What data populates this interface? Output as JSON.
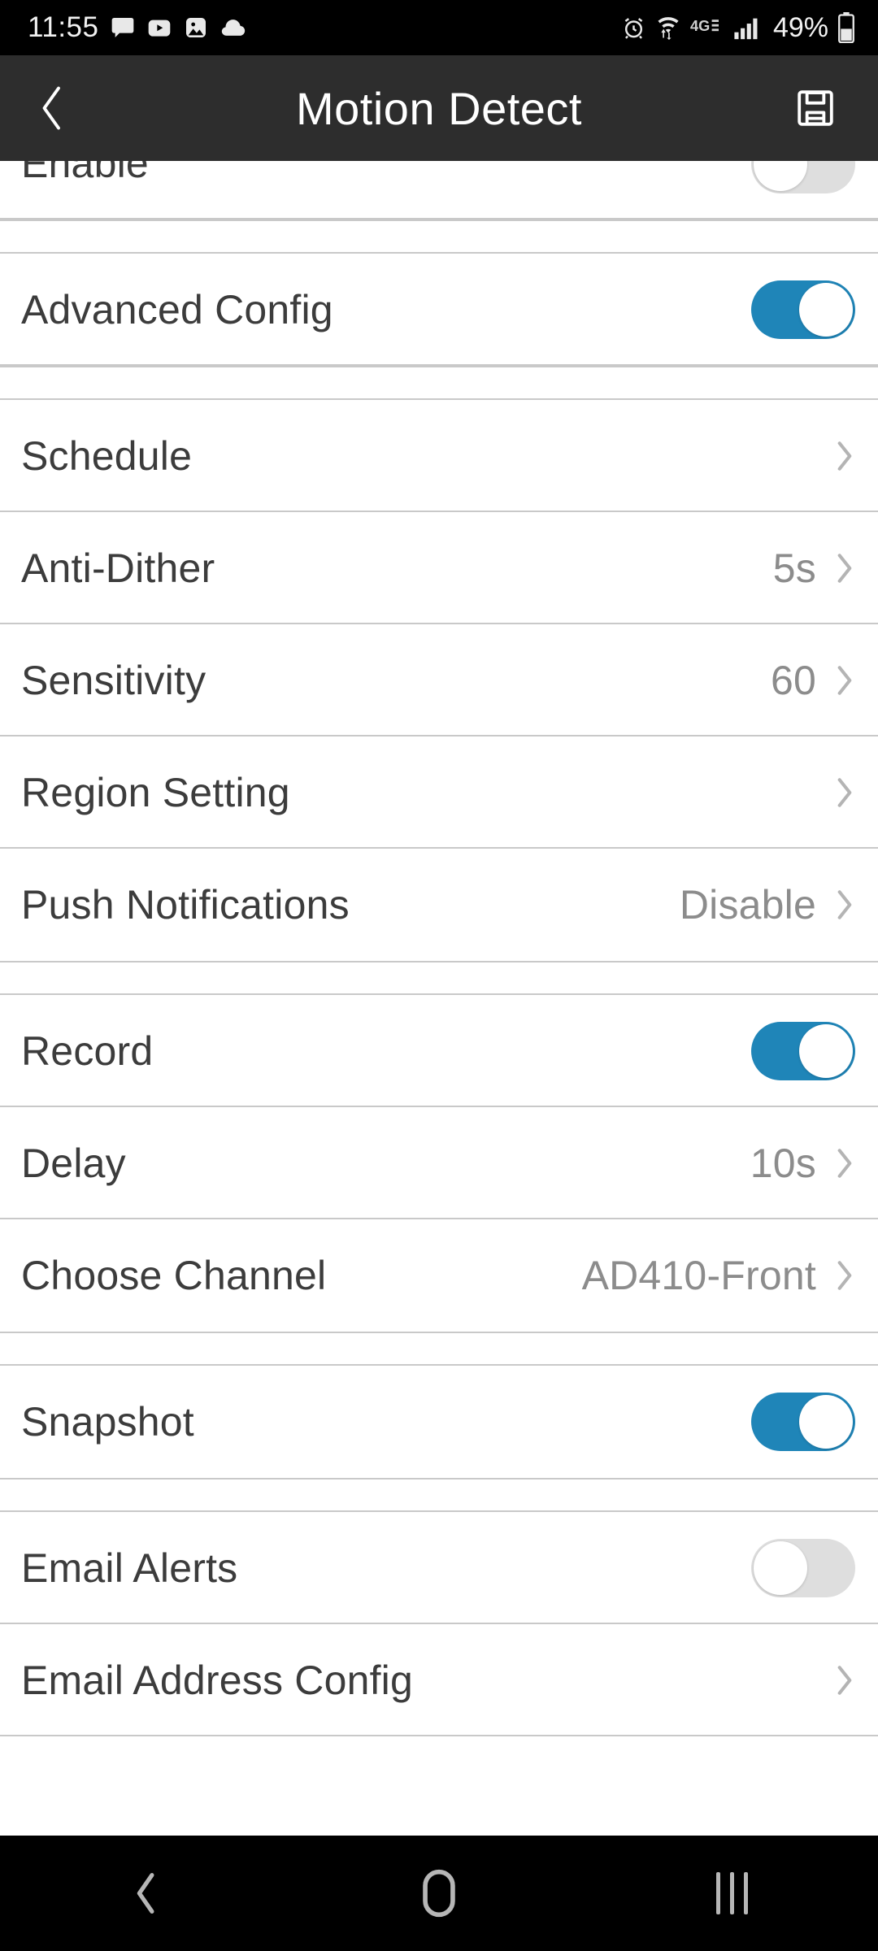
{
  "status_bar": {
    "time": "11:55",
    "left_icons": [
      "message-icon",
      "youtube-icon",
      "photos-icon",
      "cloud-icon"
    ],
    "right_icons": [
      "alarm-icon",
      "wifi-transfer-icon",
      "4g-lte-icon",
      "signal-bars-icon"
    ],
    "network_label": "4G",
    "battery_percent": "49%"
  },
  "header": {
    "back_label": "back-chevron",
    "title": "Motion Detect",
    "save_label": "save-icon"
  },
  "colors": {
    "toggle_on": "#1f85b8",
    "toggle_off": "#dedede",
    "header_bg": "#2d2d2d",
    "label_text": "#3c3c3c",
    "value_text": "#8c8c8c",
    "chevron": "#b4b4b4",
    "separator": "#c9c9c9"
  },
  "sections": [
    {
      "rows": [
        {
          "name": "enable",
          "label": "Enable",
          "control": "toggle",
          "state": "off",
          "clipped": true
        }
      ]
    },
    {
      "rows": [
        {
          "name": "advanced-config",
          "label": "Advanced Config",
          "control": "toggle",
          "state": "on"
        }
      ]
    },
    {
      "rows": [
        {
          "name": "schedule",
          "label": "Schedule",
          "control": "chevron",
          "value": ""
        },
        {
          "name": "anti-dither",
          "label": "Anti-Dither",
          "control": "chevron",
          "value": "5s"
        },
        {
          "name": "sensitivity",
          "label": "Sensitivity",
          "control": "chevron",
          "value": "60"
        },
        {
          "name": "region-setting",
          "label": "Region Setting",
          "control": "chevron",
          "value": ""
        },
        {
          "name": "push-notifications",
          "label": "Push Notifications",
          "control": "chevron",
          "value": "Disable"
        }
      ]
    },
    {
      "rows": [
        {
          "name": "record",
          "label": "Record",
          "control": "toggle",
          "state": "on"
        },
        {
          "name": "delay",
          "label": "Delay",
          "control": "chevron",
          "value": "10s"
        },
        {
          "name": "choose-channel",
          "label": "Choose Channel",
          "control": "chevron",
          "value": "AD410-Front"
        }
      ]
    },
    {
      "rows": [
        {
          "name": "snapshot",
          "label": "Snapshot",
          "control": "toggle",
          "state": "on"
        }
      ]
    },
    {
      "rows": [
        {
          "name": "email-alerts",
          "label": "Email Alerts",
          "control": "toggle",
          "state": "off"
        },
        {
          "name": "email-address-config",
          "label": "Email Address Config",
          "control": "chevron",
          "value": ""
        }
      ]
    }
  ],
  "nav_bar": {
    "back": "back-icon",
    "home": "home-icon",
    "recents": "recents-icon"
  }
}
